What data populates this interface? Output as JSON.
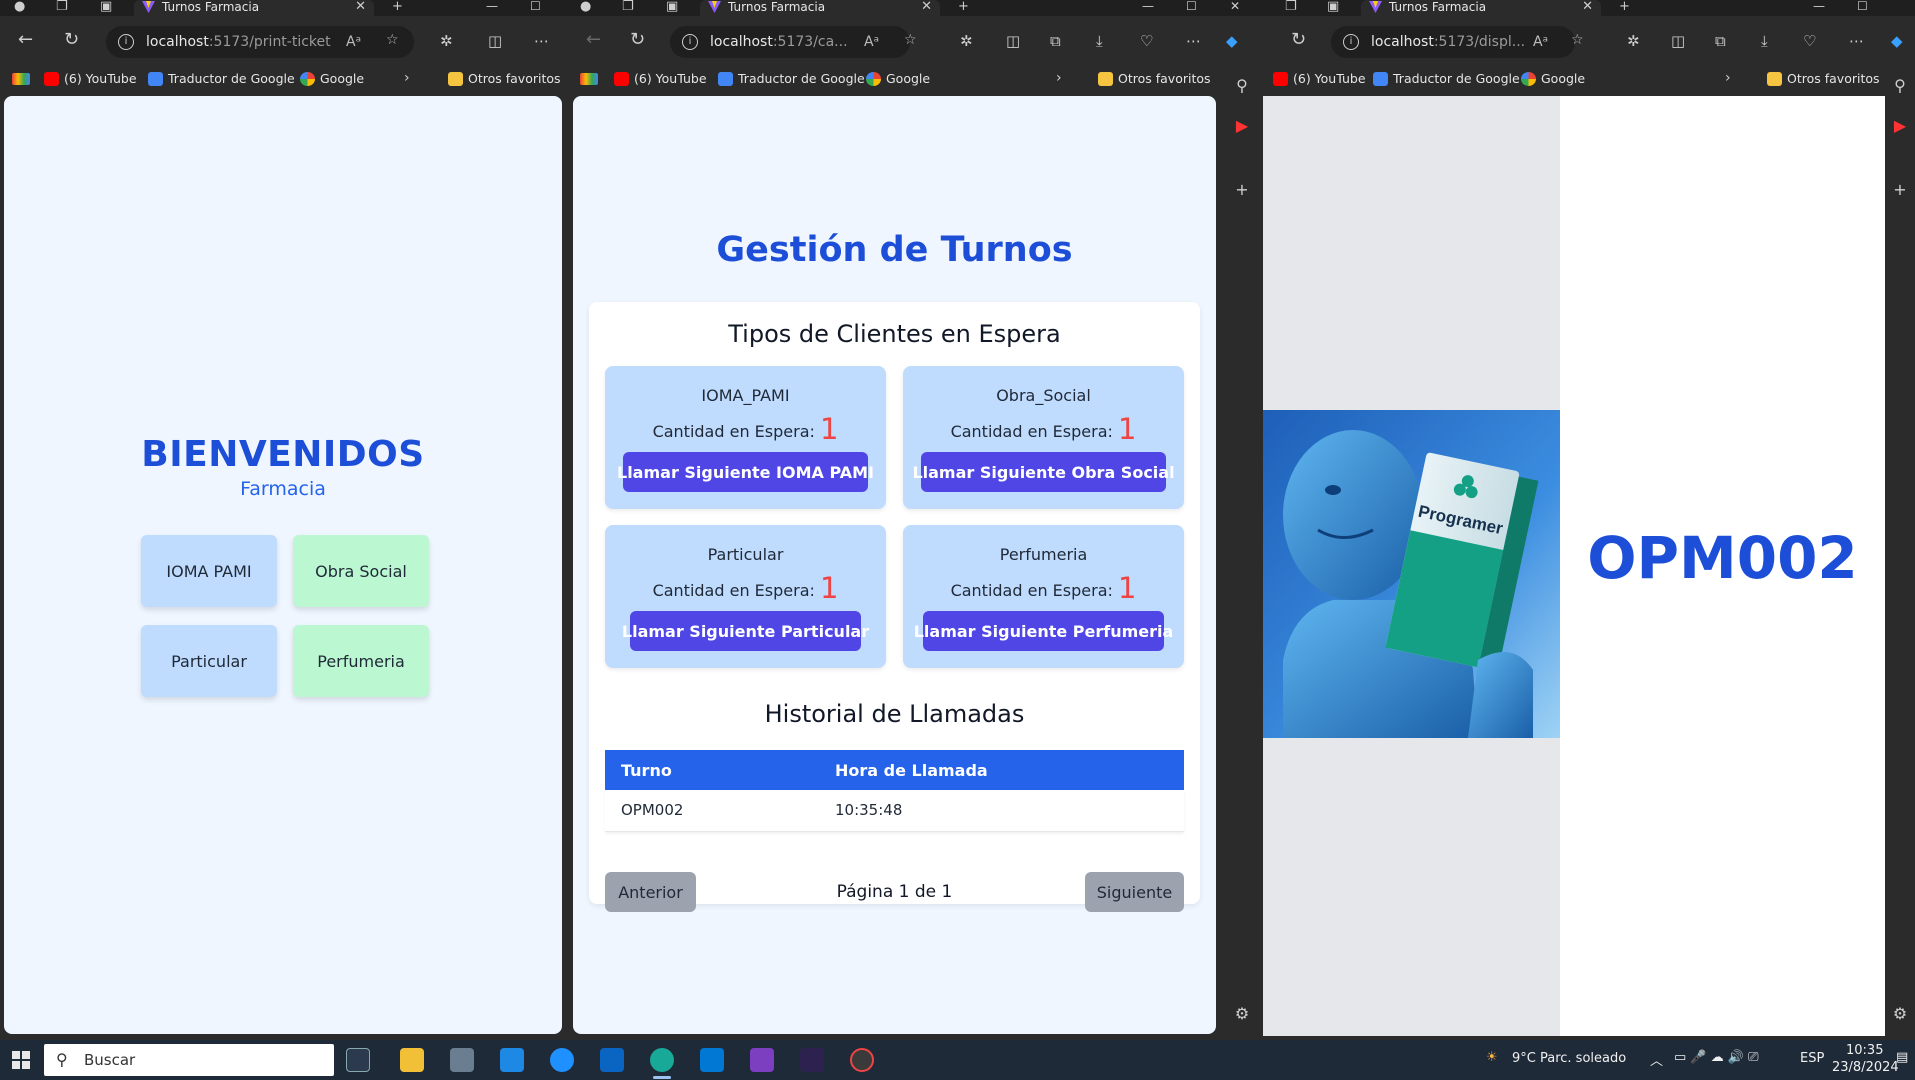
{
  "browser": {
    "tab_title": "Turnos Farmacia",
    "bookmarks": {
      "youtube": "(6) YouTube",
      "translate": "Traductor de Google",
      "google": "Google",
      "others": "Otros favoritos"
    },
    "windows": [
      {
        "url_host": "localhost",
        "url_path": ":5173/print-ticket"
      },
      {
        "url_host": "localhost",
        "url_path": ":5173/ca..."
      },
      {
        "url_host": "localhost",
        "url_path": ":5173/displ..."
      }
    ]
  },
  "print_ticket": {
    "title": "BIENVENIDOS",
    "subtitle": "Farmacia",
    "buttons": [
      "IOMA PAMI",
      "Obra Social",
      "Particular",
      "Perfumeria"
    ]
  },
  "management": {
    "title": "Gestión de Turnos",
    "queues_heading": "Tipos de Clientes en Espera",
    "count_label": "Cantidad en Espera:",
    "queues": [
      {
        "name": "IOMA_PAMI",
        "count": "1",
        "button": "Llamar Siguiente IOMA PAMI"
      },
      {
        "name": "Obra_Social",
        "count": "1",
        "button": "Llamar Siguiente Obra Social"
      },
      {
        "name": "Particular",
        "count": "1",
        "button": "Llamar Siguiente Particular"
      },
      {
        "name": "Perfumeria",
        "count": "1",
        "button": "Llamar Siguiente Perfumeria"
      }
    ],
    "history_heading": "Historial de Llamadas",
    "history_columns": [
      "Turno",
      "Hora de Llamada"
    ],
    "history_rows": [
      {
        "turno": "OPM002",
        "hora": "10:35:48"
      }
    ],
    "prev_label": "Anterior",
    "next_label": "Siguiente",
    "page_info": "Página 1 de 1"
  },
  "display": {
    "current_ticket": "OPM002",
    "promo_brand": "Programer"
  },
  "taskbar": {
    "search_placeholder": "Buscar",
    "weather": "9°C  Parc. soleado",
    "language": "ESP",
    "time": "10:35",
    "date": "23/8/2024"
  }
}
